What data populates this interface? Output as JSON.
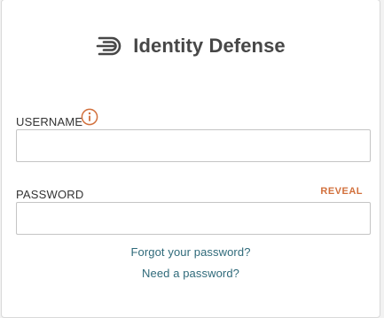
{
  "brand": {
    "name": "Identity Defense",
    "color": "#474747"
  },
  "form": {
    "username_label": "USERNAME",
    "username_info_icon": "info-circle-icon",
    "username_value": "",
    "password_label": "PASSWORD",
    "password_value": "",
    "reveal_label": "REVEAL",
    "accent_color": "#d2703c"
  },
  "links": {
    "forgot_password": "Forgot your password?",
    "need_password": "Need a password?",
    "color": "#2f6a7a"
  }
}
